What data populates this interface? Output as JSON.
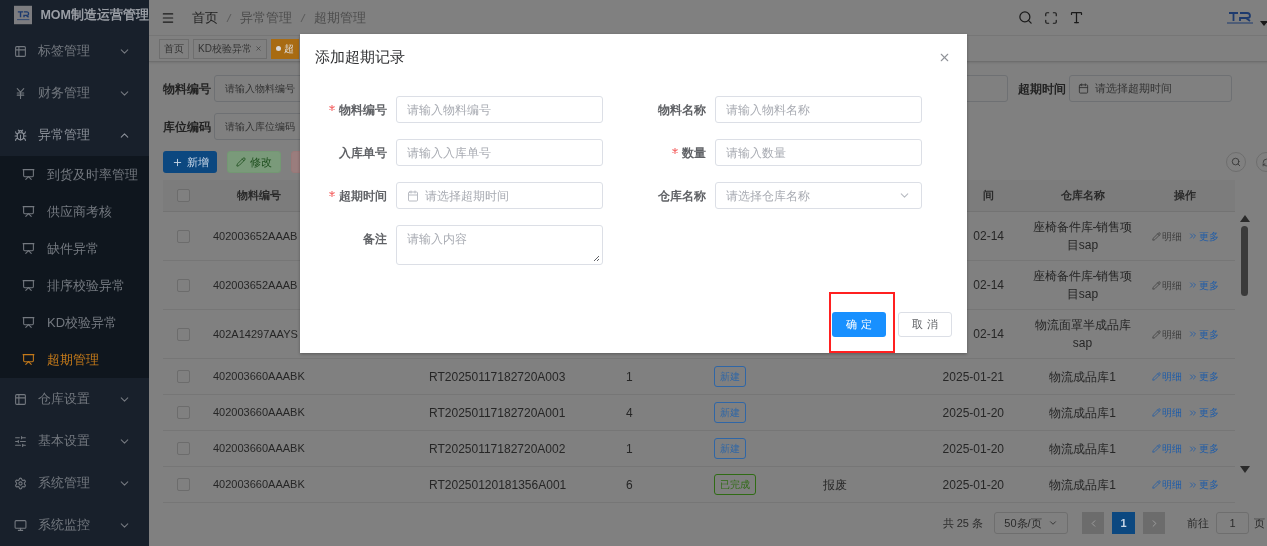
{
  "sidebar": {
    "title": "MOM制造运营管理",
    "items": [
      {
        "label": "标签管理",
        "expanded": false
      },
      {
        "label": "财务管理",
        "expanded": false
      },
      {
        "label": "异常管理",
        "expanded": true,
        "children": [
          {
            "label": "到货及时率管理",
            "selected": false
          },
          {
            "label": "供应商考核",
            "selected": false
          },
          {
            "label": "缺件异常",
            "selected": false
          },
          {
            "label": "排序校验异常",
            "selected": false
          },
          {
            "label": "KD校验异常",
            "selected": false
          },
          {
            "label": "超期管理",
            "selected": true
          }
        ]
      },
      {
        "label": "仓库设置",
        "expanded": false
      },
      {
        "label": "基本设置",
        "expanded": false
      },
      {
        "label": "系统管理",
        "expanded": false
      },
      {
        "label": "系统监控",
        "expanded": false
      }
    ]
  },
  "breadcrumb": [
    "首页",
    "异常管理",
    "超期管理"
  ],
  "tabs": [
    {
      "label": "首页",
      "closable": false,
      "selected": false
    },
    {
      "label": "KD校验异常",
      "closable": true,
      "selected": false
    },
    {
      "label": "超",
      "closable": false,
      "selected": true
    }
  ],
  "search_form": {
    "fields": [
      {
        "label": "物料编号",
        "placeholder": "请输入物料编号",
        "kind": "text"
      },
      {
        "label": "超期时间",
        "placeholder": "请选择超期时间",
        "kind": "date"
      },
      {
        "label": "库位编码",
        "placeholder": "请输入库位编码",
        "kind": "text"
      }
    ]
  },
  "toolbar": {
    "buttons": [
      {
        "label": "新增",
        "kind": "primary",
        "disabled": false
      },
      {
        "label": "修改",
        "kind": "success",
        "disabled": true
      },
      {
        "kind": "danger",
        "disabled": true
      }
    ]
  },
  "table": {
    "all_checked": false,
    "columns": {
      "material_code": "物料编号",
      "date": "间",
      "warehouse": "仓库名称",
      "actions": "操作"
    },
    "rows": [
      {
        "checked": false,
        "material_code": "402003652AAAB",
        "date": "02-14",
        "warehouse": "座椅备件库-销售项目sap",
        "detail": "明细",
        "detail_enabled": false,
        "more": "更多"
      },
      {
        "checked": false,
        "material_code": "402003652AAAB",
        "date": "02-14",
        "warehouse": "座椅备件库-销售项目sap",
        "detail": "明细",
        "detail_enabled": false,
        "more": "更多"
      },
      {
        "checked": false,
        "material_code": "402A14297AAYS",
        "date": "02-14",
        "warehouse": "物流面罩半成品库sap",
        "detail": "明细",
        "detail_enabled": false,
        "more": "更多"
      },
      {
        "checked": false,
        "material_code": "402003660AAABK",
        "receipt_no": "RT20250117182720A003",
        "quantity": "1",
        "status": {
          "label": "新建",
          "color": "#2f66a6"
        },
        "date": "2025-01-21",
        "warehouse": "物流成品库1",
        "detail": "明细",
        "detail_enabled": true,
        "more": "更多"
      },
      {
        "checked": false,
        "material_code": "402003660AAABK",
        "receipt_no": "RT20250117182720A001",
        "quantity": "4",
        "status": {
          "label": "新建",
          "color": "#2f66a6"
        },
        "date": "2025-01-20",
        "warehouse": "物流成品库1",
        "detail": "明细",
        "detail_enabled": true,
        "more": "更多"
      },
      {
        "checked": false,
        "material_code": "402003660AAABK",
        "receipt_no": "RT20250117182720A002",
        "quantity": "1",
        "status": {
          "label": "新建",
          "color": "#2f66a6"
        },
        "date": "2025-01-20",
        "warehouse": "物流成品库1",
        "detail": "明细",
        "detail_enabled": true,
        "more": "更多"
      },
      {
        "checked": false,
        "material_code": "402003660AAABK",
        "receipt_no": "RT20250120181356A001",
        "quantity": "6",
        "status": {
          "label": "已完成",
          "color": "#2f6b14"
        },
        "remark": "报废",
        "date": "2025-01-20",
        "warehouse": "物流成品库1",
        "detail": "明细",
        "detail_enabled": true,
        "more": "更多"
      }
    ]
  },
  "pagination": {
    "total": "共 25 条",
    "page_size": "50条/页",
    "pages": [
      {
        "label": "1",
        "selected": true
      }
    ],
    "goto_label": "前往",
    "goto_value": "1",
    "page_suffix": "页"
  },
  "dialog": {
    "title": "添加超期记录",
    "fields": [
      {
        "label": "物料编号",
        "required": true,
        "placeholder": "请输入物料编号",
        "kind": "text"
      },
      {
        "label": "物料名称",
        "required": false,
        "placeholder": "请输入物料名称",
        "kind": "text"
      },
      {
        "label": "入库单号",
        "required": false,
        "placeholder": "请输入入库单号",
        "kind": "text"
      },
      {
        "label": "数量",
        "required": true,
        "placeholder": "请输入数量",
        "kind": "text"
      },
      {
        "label": "超期时间",
        "required": true,
        "placeholder": "请选择超期时间",
        "kind": "date"
      },
      {
        "label": "仓库名称",
        "required": false,
        "placeholder": "请选择仓库名称",
        "kind": "select"
      },
      {
        "label": "备注",
        "required": false,
        "placeholder": "请输入内容",
        "kind": "textarea"
      }
    ],
    "buttons": [
      {
        "label": "确 定",
        "kind": "primary",
        "highlighted": true
      },
      {
        "label": "取 消",
        "kind": "default",
        "highlighted": false
      }
    ]
  }
}
